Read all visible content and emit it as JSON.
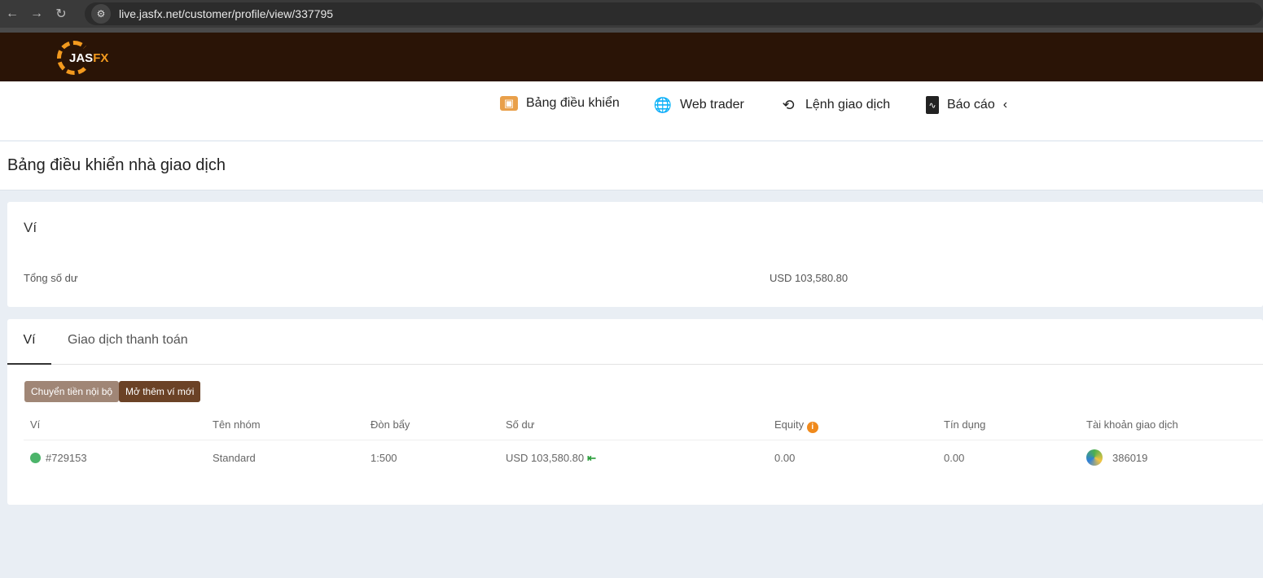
{
  "browser": {
    "url": "live.jasfx.net/customer/profile/view/337795"
  },
  "brand": {
    "name_a": "JAS",
    "name_b": "FX",
    "accent": "#f39a1e",
    "bar": "#2a1406"
  },
  "menu": [
    {
      "label": "Bảng điều khiển",
      "icon": "id-card-icon"
    },
    {
      "label": "Web trader",
      "icon": "globe-icon"
    },
    {
      "label": "Lệnh giao dịch",
      "icon": "history-icon"
    },
    {
      "label": "Báo cáo",
      "icon": "report-icon"
    }
  ],
  "page_title": "Bảng điều khiển nhà giao dịch",
  "wallet_card": {
    "title": "Ví",
    "total_label": "Tổng số dư",
    "total_value": "USD 103,580.80"
  },
  "tabs": [
    {
      "label": "Ví"
    },
    {
      "label": "Giao dịch thanh toán"
    }
  ],
  "buttons": {
    "transfer": "Chuyển tiền nội bộ",
    "new_wallet": "Mở thêm ví mới"
  },
  "table": {
    "headers": [
      "Ví",
      "Tên nhóm",
      "Đòn bẩy",
      "Số dư",
      "Equity",
      "Tín dụng",
      "Tài khoản giao dịch"
    ],
    "rows": [
      {
        "wallet": "#729153",
        "group": "Standard",
        "leverage": "1:500",
        "balance": "USD 103,580.80",
        "equity": "0.00",
        "credit": "0.00",
        "account": "386019"
      }
    ]
  }
}
